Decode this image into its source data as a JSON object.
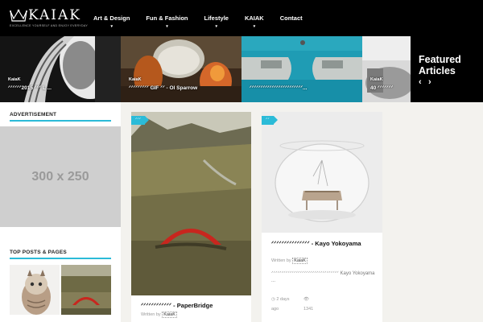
{
  "header": {
    "logo_text": "KAIAK",
    "logo_tagline": "EXCELLENCE YOURSELF AND ENJOY EVERYDAY",
    "nav": [
      {
        "label": "Art & Design",
        "has_dropdown": true
      },
      {
        "label": "Fun & Fashion",
        "has_dropdown": true
      },
      {
        "label": "Lifestyle",
        "has_dropdown": true
      },
      {
        "label": "KAIAK",
        "has_dropdown": true
      },
      {
        "label": "Contact",
        "has_dropdown": false
      }
    ]
  },
  "featured": {
    "heading": "Featured Articles",
    "prev_icon": "‹",
    "next_icon": "›",
    "items": [
      {
        "author": "KaiaK",
        "caption": "ᐟᐟᐟᐟᐟᐟ2015 ᐟᐟᐟ L ..."
      },
      {
        "author": "KaiaK",
        "caption": "ᐟᐟᐟᐟᐟᐟᐟᐟᐟ GIF ᐟᐟ - Ol Sparrow"
      },
      {
        "author": "",
        "caption": "ᐟᐟᐟᐟᐟᐟᐟᐟᐟᐟᐟᐟᐟᐟᐟᐟᐟᐟᐟᐟᐟᐟᐟᐟ..."
      },
      {
        "author": "KaiaK",
        "caption": "40 ᐟᐟᐟᐟᐟᐟᐟ"
      }
    ]
  },
  "sidebar": {
    "advertisement_heading": "ADVERTISEMENT",
    "ad_placeholder": "300 x 250",
    "top_posts_heading": "TOP POSTS & PAGES"
  },
  "cards": [
    {
      "badge": "ᐟᐟᐟ",
      "title": "ᐟᐟᐟᐟᐟᐟᐟᐟᐟᐟᐟᐟ - PaperBridge",
      "byline_prefix": "Written by",
      "author": "KaiaK"
    },
    {
      "badge": "ᐟᐟ",
      "title": "ᐟᐟᐟᐟᐟᐟᐟᐟᐟᐟᐟᐟᐟᐟᐟ - Kayo Yokoyama",
      "byline_prefix": "Written by",
      "author": "KaiaK",
      "excerpt": "ᐟᐟᐟᐟᐟᐟᐟᐟᐟᐟᐟᐟᐟᐟᐟᐟᐟᐟᐟᐟᐟᐟᐟᐟᐟᐟᐟᐟᐟᐟᐟᐟᐟ Kayo Yokoyama ...",
      "time_icon": "◷",
      "time_ago": "2 days",
      "ago_label": "ago",
      "views_icon": "👁",
      "views": "1341"
    }
  ],
  "colors": {
    "accent": "#2bbbd8",
    "header_bg": "#000000",
    "page_bg": "#f3f2ee"
  }
}
